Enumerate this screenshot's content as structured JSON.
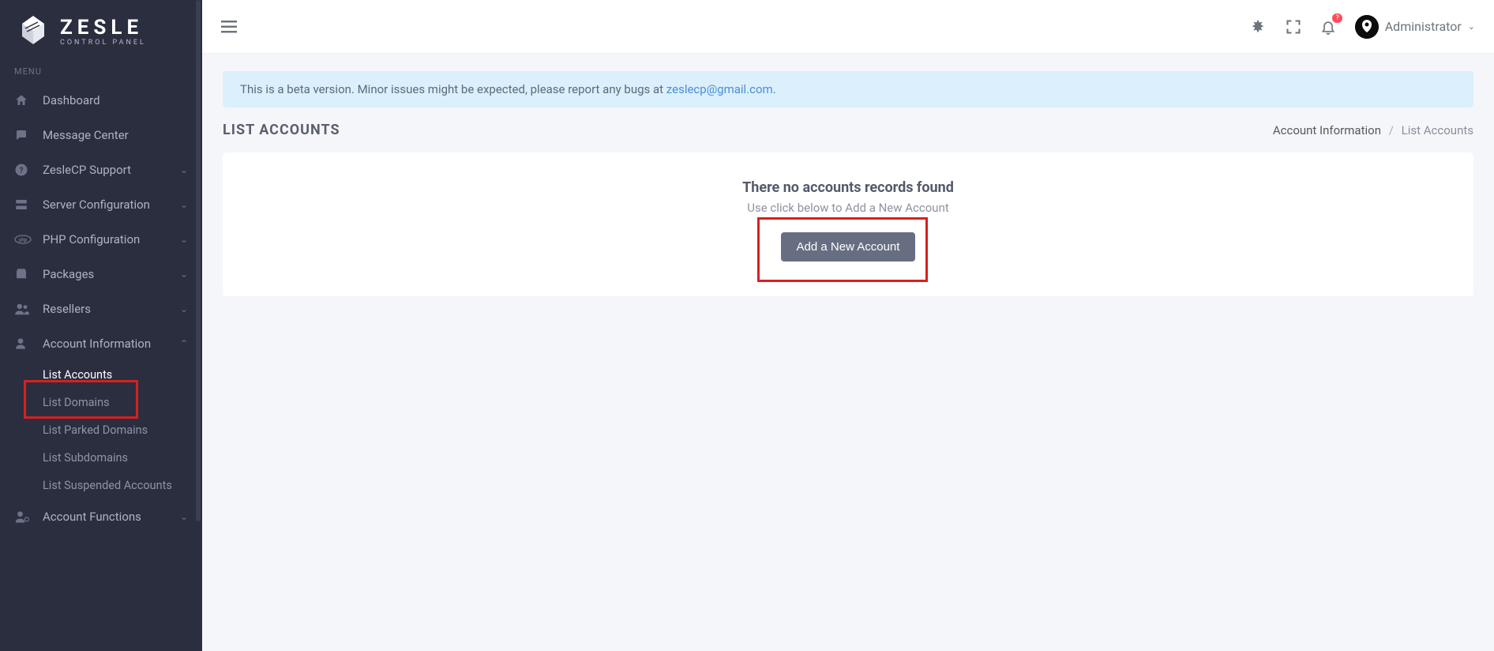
{
  "brand": {
    "name": "ZESLE",
    "tagline": "CONTROL PANEL"
  },
  "sidebar": {
    "menu_label": "MENU",
    "items": [
      {
        "label": "Dashboard",
        "icon": "home-icon"
      },
      {
        "label": "Message Center",
        "icon": "chat-icon"
      },
      {
        "label": "ZesleCP Support",
        "icon": "help-icon",
        "expandable": true
      },
      {
        "label": "Server Configuration",
        "icon": "server-icon",
        "expandable": true
      },
      {
        "label": "PHP Configuration",
        "icon": "php-icon",
        "expandable": true
      },
      {
        "label": "Packages",
        "icon": "package-icon",
        "expandable": true
      },
      {
        "label": "Resellers",
        "icon": "users-icon",
        "expandable": true
      },
      {
        "label": "Account Information",
        "icon": "user-icon",
        "expandable": true,
        "expanded": true
      },
      {
        "label": "Account Functions",
        "icon": "user-gear-icon",
        "expandable": true
      }
    ],
    "account_info_sub": [
      {
        "label": "List Accounts",
        "active": true
      },
      {
        "label": "List Domains"
      },
      {
        "label": "List Parked Domains"
      },
      {
        "label": "List Subdomains"
      },
      {
        "label": "List Suspended Accounts"
      }
    ]
  },
  "topbar": {
    "notification_badge": "?",
    "user_label": "Administrator"
  },
  "alert": {
    "prefix": "This is a beta version. Minor issues might be expected, please report any bugs at ",
    "email": "zeslecp@gmail.com",
    "suffix": "."
  },
  "page": {
    "title": "LIST ACCOUNTS",
    "breadcrumb_parent": "Account Information",
    "breadcrumb_sep": "/",
    "breadcrumb_current": "List Accounts"
  },
  "card": {
    "heading": "There no accounts records found",
    "subtext": "Use click below to Add a New Account",
    "button_label": "Add a New Account"
  }
}
